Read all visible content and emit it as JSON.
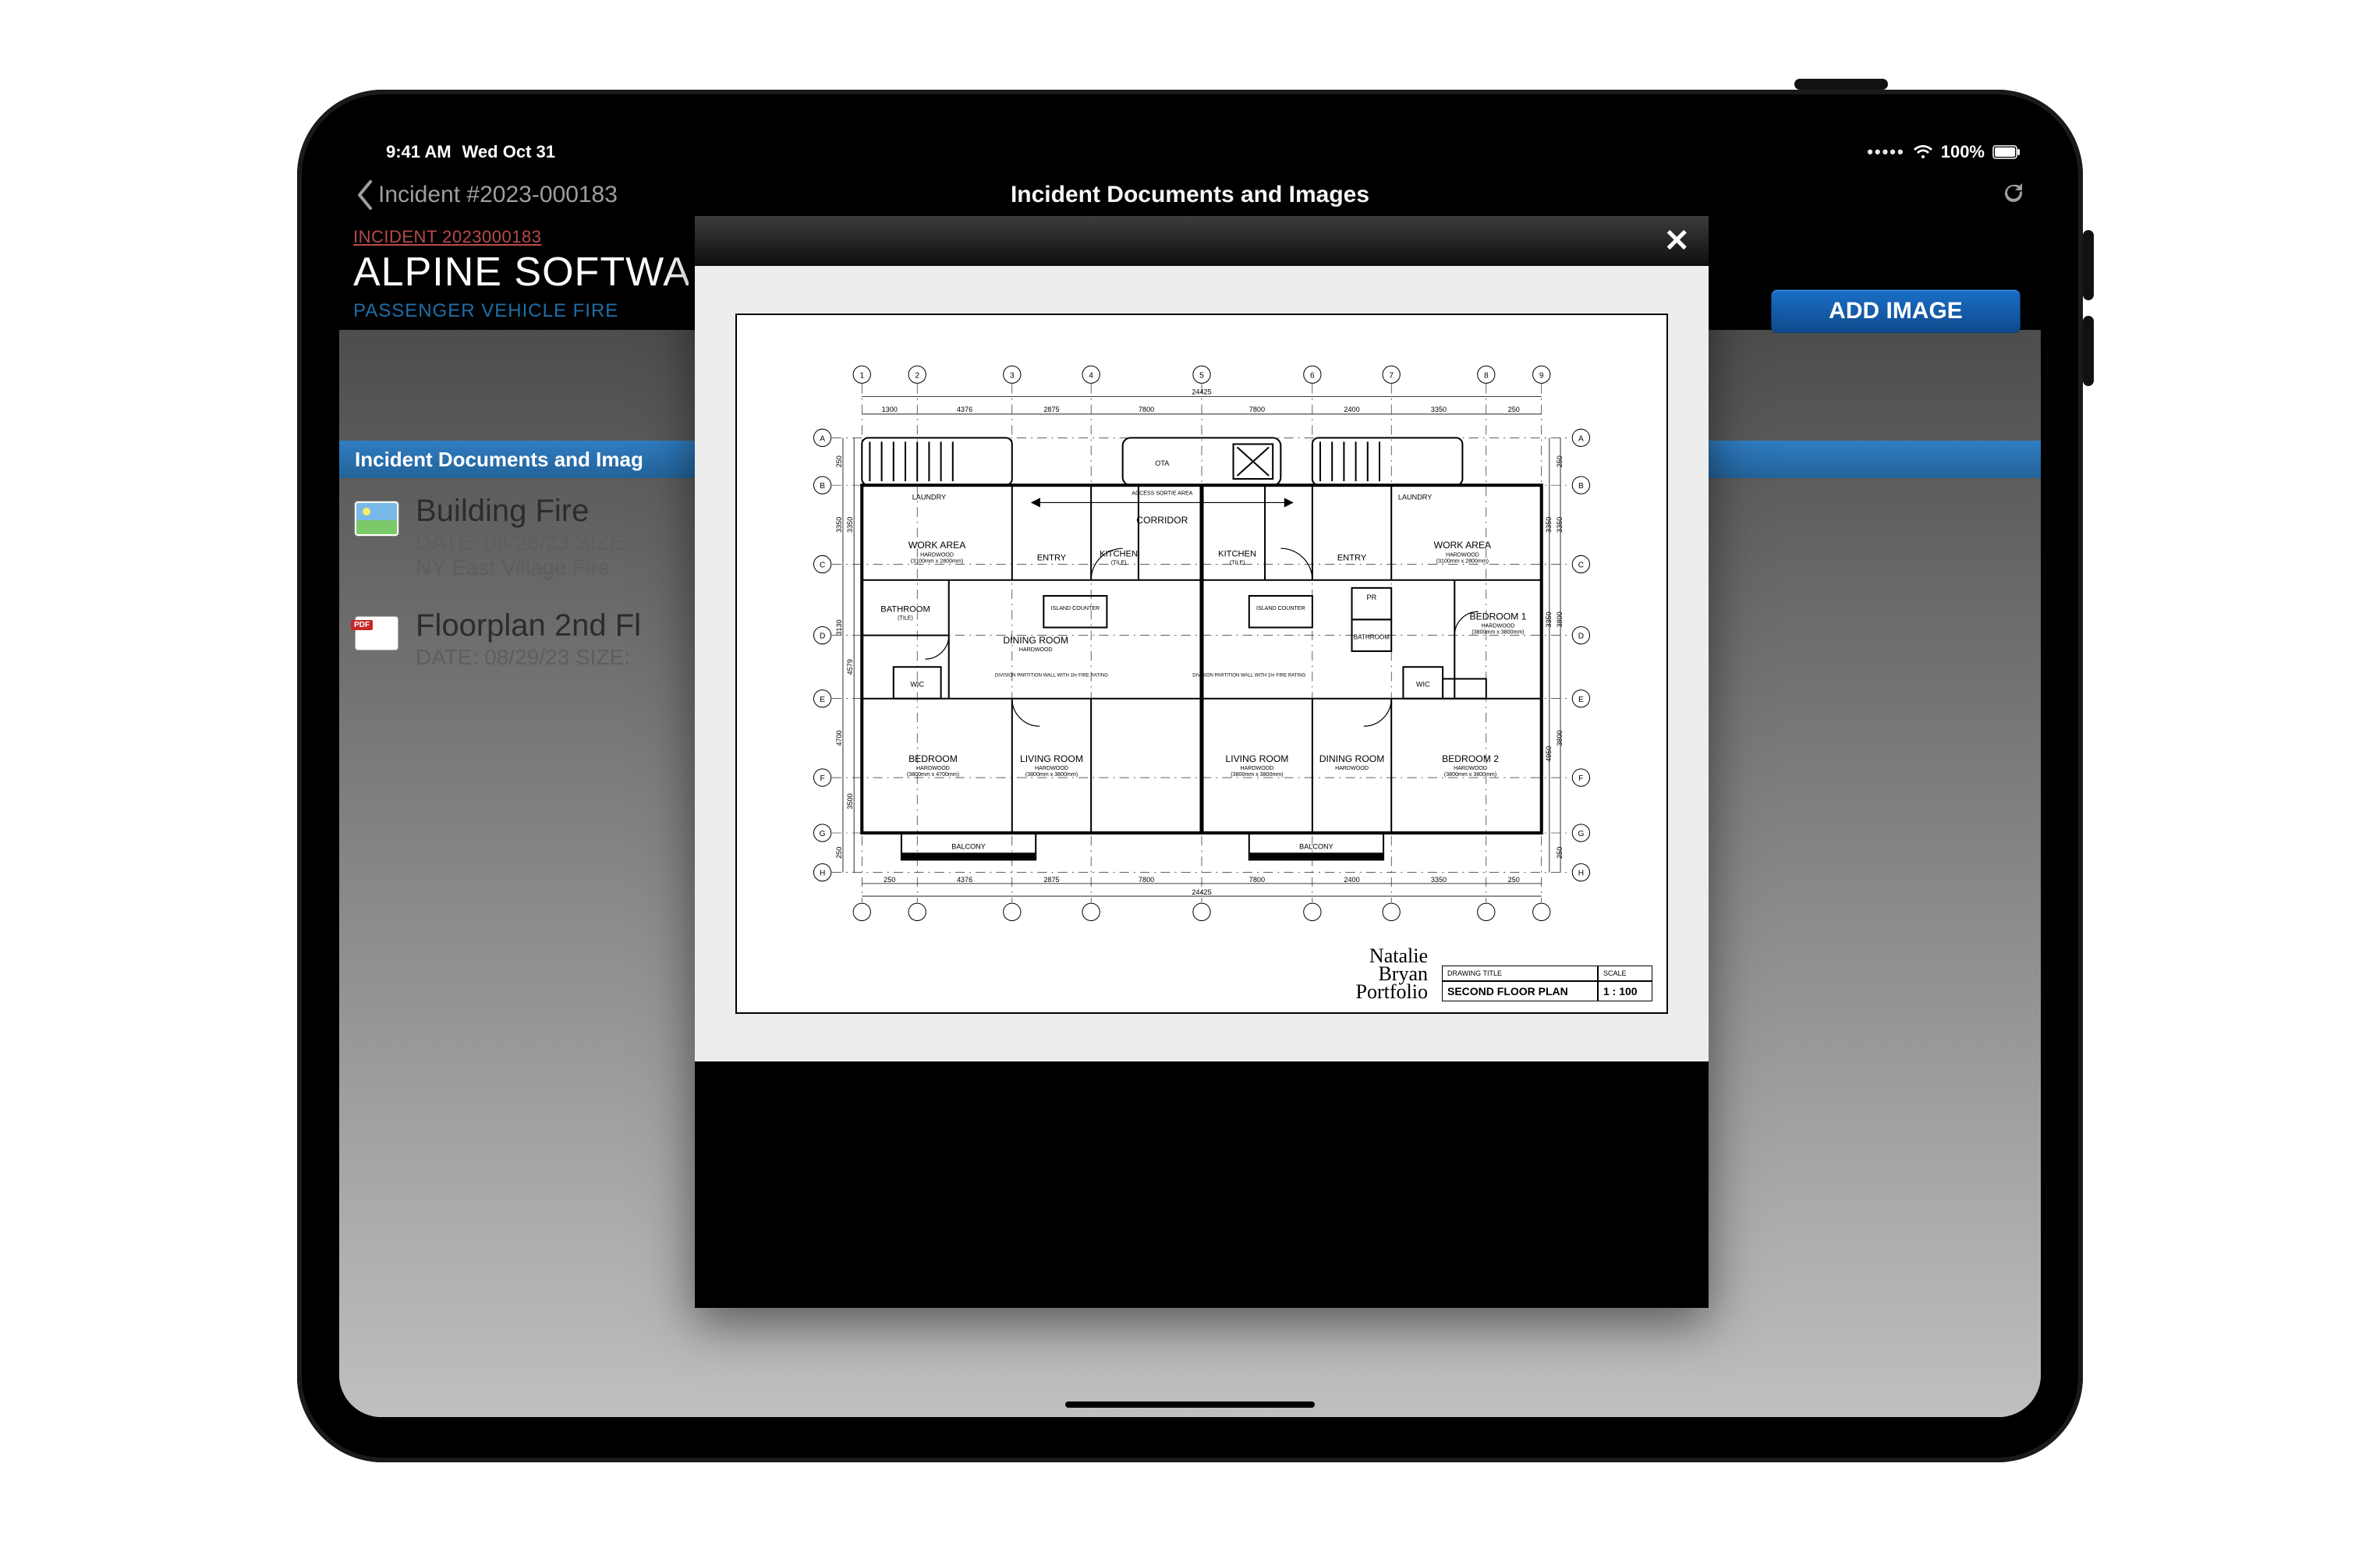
{
  "status_bar": {
    "time": "9:41 AM",
    "date": "Wed Oct 31",
    "battery_pct": "100%"
  },
  "nav": {
    "back_label": "Incident #2023-000183",
    "title": "Incident Documents and Images"
  },
  "header": {
    "incident_label": "INCIDENT 2023000183",
    "heading": "ALPINE SOFTWARE C",
    "subheading": "PASSENGER VEHICLE FIRE"
  },
  "add_image_button": "ADD IMAGE",
  "section_header": "Incident Documents and Imag",
  "documents": [
    {
      "type": "image",
      "title": "Building Fire",
      "meta": "DATE: 08/28/23 SIZE:",
      "desc": "NY East Village Fire"
    },
    {
      "type": "pdf",
      "title": "Floorplan 2nd Fl",
      "meta": "DATE: 08/29/23 SIZE:",
      "desc": ""
    }
  ],
  "modal": {
    "close_glyph": "✕"
  },
  "floorplan": {
    "drawing_title_label": "DRAWING TITLE",
    "drawing_title": "SECOND FLOOR PLAN",
    "scale_label": "SCALE",
    "scale": "1 : 100",
    "signature_lines": [
      "Natalie",
      "Bryan",
      "Portfolio"
    ],
    "rooms_left": {
      "work_area": "WORK AREA",
      "work_area_sub": "HARDWOOD",
      "work_area_dim": "(3100mm x 2800mm)",
      "laundry": "LAUNDRY",
      "entry": "ENTRY",
      "kitchen": "KITCHEN",
      "kitchen_sub": "(TILE)",
      "island": "ISLAND COUNTER",
      "bathroom": "BATHROOM",
      "bathroom_sub": "(TILE)",
      "wic": "WIC",
      "dining": "DINING ROOM",
      "dining_sub": "HARDWOOD",
      "bedroom": "BEDROOM",
      "bedroom_sub": "HARDWOOD",
      "bedroom_dim": "(3800mm x 4700mm)",
      "living": "LIVING ROOM",
      "living_sub": "HARDWOOD",
      "living_dim": "(3800mm x 3800mm)",
      "balcony": "BALCONY",
      "corridor": "CORRIDOR"
    },
    "rooms_right": {
      "work_area": "WORK AREA",
      "work_area_sub": "HARDWOOD",
      "work_area_dim": "(3100mm x 2800mm)",
      "laundry": "LAUNDRY",
      "entry": "ENTRY",
      "kitchen": "KITCHEN",
      "kitchen_sub": "(TILE)",
      "island": "ISLAND COUNTER",
      "pr": "PR",
      "bathroom": "BATHROOM",
      "wic": "WIC",
      "bedroom1": "BEDROOM 1",
      "bedroom1_sub": "HARDWOOD",
      "bedroom1_dim": "(3800mm x 3800mm)",
      "bedroom2": "BEDROOM 2",
      "bedroom2_sub": "HARDWOOD",
      "bedroom2_dim": "(3800mm x 3800mm)",
      "dining": "DINING ROOM",
      "dining_sub": "HARDWOOD",
      "living": "LIVING ROOM",
      "living_sub": "HARDWOOD",
      "living_dim": "(3800mm x 3800mm)",
      "balcony": "BALCONY",
      "ota": "OTA",
      "access_area": "ACCESS SORTIE AREA"
    },
    "partition_note_l": "DIVISION PARTITION WALL WITH 1hr FIRE RATING",
    "partition_note_r": "DIVISION PARTITION WALL WITH 1hr FIRE RATING",
    "grid_letters": [
      "A",
      "B",
      "C",
      "D",
      "E",
      "F",
      "G",
      "H"
    ],
    "grid_numbers": [
      "1",
      "2",
      "3",
      "4",
      "5",
      "6",
      "7",
      "8",
      "9"
    ],
    "dimensions_along_top": [
      "1300",
      "4376",
      "2875",
      "7800",
      "2400",
      "3350",
      "250"
    ],
    "dimension_overall_top": "24425",
    "dimensions_along_bottom": [
      "250",
      "4376",
      "2875",
      "7800",
      "2400",
      "3350",
      "250"
    ],
    "dimension_overall_bottom": "24425",
    "dimensions_along_left": [
      "250",
      "3350",
      "3130",
      "4700",
      "250"
    ],
    "dimensions_inner_left": [
      "3350",
      "4579",
      "3500"
    ],
    "dimensions_along_right": [
      "250",
      "3350",
      "3800",
      "3800",
      "250"
    ],
    "dimensions_inner_right": [
      "3350",
      "3350",
      "4950"
    ]
  }
}
